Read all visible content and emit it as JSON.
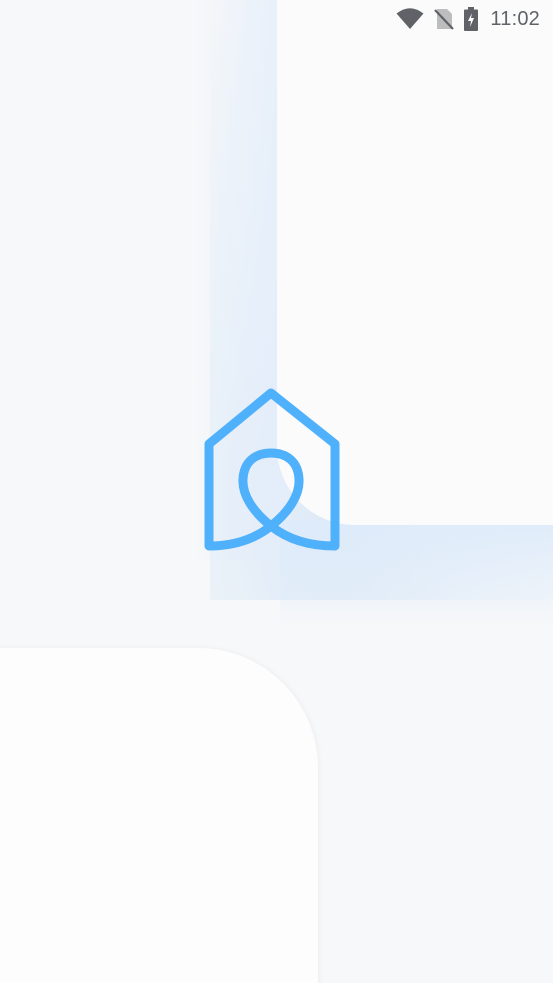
{
  "status_bar": {
    "time": "11:02",
    "icons": [
      "wifi-icon",
      "no-sim-icon",
      "battery-charging-icon"
    ]
  },
  "splash": {
    "logo_icon": "house-loop-logo-icon"
  },
  "colors": {
    "background": "#f7f8f9",
    "panel": "#fbfbfc",
    "logo_blue": "#4fb0fb",
    "status_icon": "#5f6368"
  }
}
